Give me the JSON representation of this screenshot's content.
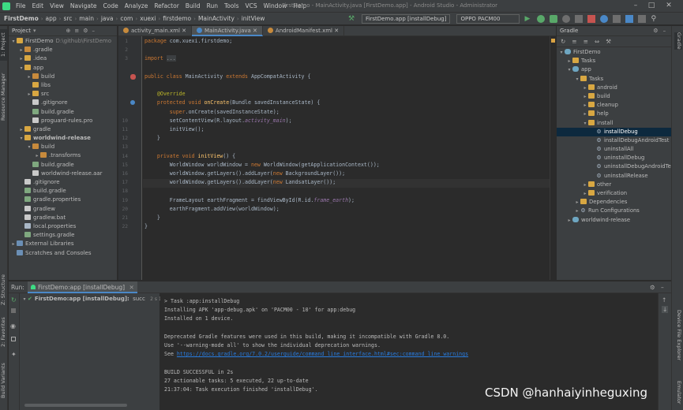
{
  "menu": [
    "File",
    "Edit",
    "View",
    "Navigate",
    "Code",
    "Analyze",
    "Refactor",
    "Build",
    "Run",
    "Tools",
    "VCS",
    "Window",
    "Help"
  ],
  "window_title": "FirstDemo - MainActivity.java [FirstDemo.app] - Android Studio - Administrator",
  "breadcrumbs": [
    "FirstDemo",
    "app",
    "src",
    "main",
    "java",
    "com",
    "xuexi",
    "firstdemo",
    "MainActivity",
    "initView"
  ],
  "run_config": "FirstDemo.app [installDebug]",
  "device": "OPPO PACM00",
  "project_panel": {
    "title": "Project",
    "items": [
      {
        "label": "FirstDemo",
        "suffix": "D:\\github\\FirstDemo",
        "depth": 0,
        "open": true,
        "icon": "folder"
      },
      {
        "label": ".gradle",
        "depth": 1,
        "open": false,
        "icon": "folder-o"
      },
      {
        "label": ".idea",
        "depth": 1,
        "open": false,
        "icon": "folder"
      },
      {
        "label": "app",
        "depth": 1,
        "open": true,
        "icon": "folder"
      },
      {
        "label": "build",
        "depth": 2,
        "open": false,
        "icon": "folder-o"
      },
      {
        "label": "libs",
        "depth": 2,
        "open": null,
        "icon": "folder"
      },
      {
        "label": "src",
        "depth": 2,
        "open": false,
        "icon": "folder"
      },
      {
        "label": ".gitignore",
        "depth": 2,
        "open": null,
        "icon": "file-x"
      },
      {
        "label": "build.gradle",
        "depth": 2,
        "open": null,
        "icon": "file-g"
      },
      {
        "label": "proguard-rules.pro",
        "depth": 2,
        "open": null,
        "icon": "file-x"
      },
      {
        "label": "gradle",
        "depth": 1,
        "open": false,
        "icon": "folder"
      },
      {
        "label": "worldwind-release",
        "depth": 1,
        "open": true,
        "icon": "folder",
        "bold": true
      },
      {
        "label": "build",
        "depth": 2,
        "open": true,
        "icon": "folder-o"
      },
      {
        "label": ".transforms",
        "depth": 3,
        "open": false,
        "icon": "folder-o"
      },
      {
        "label": "build.gradle",
        "depth": 2,
        "open": null,
        "icon": "file-g"
      },
      {
        "label": "worldwind-release.aar",
        "depth": 2,
        "open": null,
        "icon": "file-x"
      },
      {
        "label": ".gitignore",
        "depth": 1,
        "open": null,
        "icon": "file-x"
      },
      {
        "label": "build.gradle",
        "depth": 1,
        "open": null,
        "icon": "file-g"
      },
      {
        "label": "gradle.properties",
        "depth": 1,
        "open": null,
        "icon": "file-g"
      },
      {
        "label": "gradlew",
        "depth": 1,
        "open": null,
        "icon": "file-x"
      },
      {
        "label": "gradlew.bat",
        "depth": 1,
        "open": null,
        "icon": "file-x"
      },
      {
        "label": "local.properties",
        "depth": 1,
        "open": null,
        "icon": "file-p"
      },
      {
        "label": "settings.gradle",
        "depth": 1,
        "open": null,
        "icon": "file-g"
      },
      {
        "label": "External Libraries",
        "depth": 0,
        "open": false,
        "icon": "folder-b"
      },
      {
        "label": "Scratches and Consoles",
        "depth": 0,
        "open": null,
        "icon": "folder-b"
      }
    ]
  },
  "editor_tabs": [
    {
      "label": "activity_main.xml",
      "active": false
    },
    {
      "label": "MainActivity.java",
      "active": true
    },
    {
      "label": "AndroidManifest.xml",
      "active": false
    }
  ],
  "code": {
    "line_numbers": [
      "1",
      "2",
      "3",
      "",
      "",
      "",
      "",
      "",
      "",
      "10",
      "11",
      "12",
      "13",
      "14",
      "15",
      "16",
      "17",
      "18",
      "19",
      "20",
      "21",
      "22",
      "23",
      "24",
      "25",
      "26"
    ],
    "lines": [
      [
        {
          "t": "package ",
          "c": "kw"
        },
        {
          "t": "com.xuexi.firstdemo;"
        }
      ],
      [],
      [
        {
          "t": "import ",
          "c": "kw"
        },
        {
          "t": "...",
          "c": "fold"
        }
      ],
      [],
      [
        {
          "t": "public class ",
          "c": "kw"
        },
        {
          "t": "MainActivity "
        },
        {
          "t": "extends ",
          "c": "kw"
        },
        {
          "t": "AppCompatActivity {"
        }
      ],
      [],
      [
        {
          "t": "    @Override",
          "c": "an"
        }
      ],
      [
        {
          "t": "    protected void ",
          "c": "kw"
        },
        {
          "t": "onCreate",
          "c": "fn"
        },
        {
          "t": "(Bundle savedInstanceState) {"
        }
      ],
      [
        {
          "t": "        super",
          "c": "kw"
        },
        {
          "t": ".onCreate(savedInstanceState);"
        }
      ],
      [
        {
          "t": "        setContentView(R.layout."
        },
        {
          "t": "activity_main",
          "c": "it"
        },
        {
          "t": ");"
        }
      ],
      [
        {
          "t": "        initView();"
        }
      ],
      [
        {
          "t": "    }"
        }
      ],
      [],
      [
        {
          "t": "    private void ",
          "c": "kw"
        },
        {
          "t": "initView",
          "c": "fn"
        },
        {
          "t": "() {"
        }
      ],
      [
        {
          "t": "        WorldWindow worldWindow = "
        },
        {
          "t": "new ",
          "c": "kw"
        },
        {
          "t": "WorldWindow(getApplicationContext());"
        }
      ],
      [
        {
          "t": "        worldWindow.getLayers().addLayer("
        },
        {
          "t": "new ",
          "c": "kw"
        },
        {
          "t": "BackgroundLayer());"
        }
      ],
      [
        {
          "t": "        worldWindow.getLayers().addLayer("
        },
        {
          "t": "new ",
          "c": "kw"
        },
        {
          "t": "LandsatLayer());"
        }
      ],
      [],
      [
        {
          "t": "        FrameLayout earthFragment = findViewById(R.id."
        },
        {
          "t": "frame_earth",
          "c": "it"
        },
        {
          "t": ");"
        }
      ],
      [
        {
          "t": "        earthFragment.addView(worldWindow);"
        }
      ],
      [
        {
          "t": "    }"
        }
      ],
      [
        {
          "t": "}"
        }
      ]
    ]
  },
  "gradle_panel": {
    "title": "Gradle",
    "items": [
      {
        "label": "FirstDemo",
        "depth": 0,
        "open": true,
        "icon": "gradle"
      },
      {
        "label": "Tasks",
        "depth": 1,
        "open": false,
        "icon": "folder"
      },
      {
        "label": "app",
        "depth": 1,
        "open": true,
        "icon": "gradle"
      },
      {
        "label": "Tasks",
        "depth": 2,
        "open": true,
        "icon": "folder"
      },
      {
        "label": "android",
        "depth": 3,
        "open": false,
        "icon": "folder"
      },
      {
        "label": "build",
        "depth": 3,
        "open": false,
        "icon": "folder"
      },
      {
        "label": "cleanup",
        "depth": 3,
        "open": false,
        "icon": "folder"
      },
      {
        "label": "help",
        "depth": 3,
        "open": false,
        "icon": "folder"
      },
      {
        "label": "install",
        "depth": 3,
        "open": true,
        "icon": "folder"
      },
      {
        "label": "installDebug",
        "depth": 4,
        "open": null,
        "icon": "gear",
        "selected": true
      },
      {
        "label": "installDebugAndroidTest",
        "depth": 4,
        "open": null,
        "icon": "gear"
      },
      {
        "label": "uninstallAll",
        "depth": 4,
        "open": null,
        "icon": "gear"
      },
      {
        "label": "uninstallDebug",
        "depth": 4,
        "open": null,
        "icon": "gear"
      },
      {
        "label": "uninstallDebugAndroidTest",
        "depth": 4,
        "open": null,
        "icon": "gear"
      },
      {
        "label": "uninstallRelease",
        "depth": 4,
        "open": null,
        "icon": "gear"
      },
      {
        "label": "other",
        "depth": 3,
        "open": false,
        "icon": "folder"
      },
      {
        "label": "verification",
        "depth": 3,
        "open": false,
        "icon": "folder"
      },
      {
        "label": "Dependencies",
        "depth": 2,
        "open": false,
        "icon": "folder"
      },
      {
        "label": "Run Configurations",
        "depth": 2,
        "open": false,
        "icon": "gear"
      },
      {
        "label": "worldwind-release",
        "depth": 1,
        "open": false,
        "icon": "gradle"
      }
    ]
  },
  "run_panel": {
    "label": "Run:",
    "tab": "FirstDemo:app [installDebug]",
    "tree_item": "FirstDemo:app [installDebug]:",
    "tree_status": "succ",
    "tree_time": "2 s 160 ms",
    "console": [
      "> Task :app:installDebug",
      "Installing APK 'app-debug.apk' on 'PACM00 - 10' for app:debug",
      "Installed on 1 device.",
      "",
      "Deprecated Gradle features were used in this build, making it incompatible with Gradle 8.0.",
      "Use '--warning-mode all' to show the individual deprecation warnings.",
      "See ",
      "",
      "BUILD SUCCESSFUL in 2s",
      "27 actionable tasks: 5 executed, 22 up-to-date",
      "21:37:04: Task execution finished 'installDebug'."
    ],
    "console_link": "https://docs.gradle.org/7.0.2/userguide/command_line_interface.html#sec:command_line_warnings"
  },
  "side_tabs_left": [
    "1: Project",
    "Resource Manager",
    "Z: Structure",
    "2: Favorites",
    "Build Variants"
  ],
  "side_tabs_right": [
    "Gradle",
    "Device File Explorer",
    "Emulator"
  ],
  "watermark": "CSDN @hanhaiyinheguxing",
  "colors": {
    "bg": "#2b2b2b",
    "panel": "#3c3f41",
    "selection": "#0d293e",
    "accent": "#4a88c7"
  }
}
